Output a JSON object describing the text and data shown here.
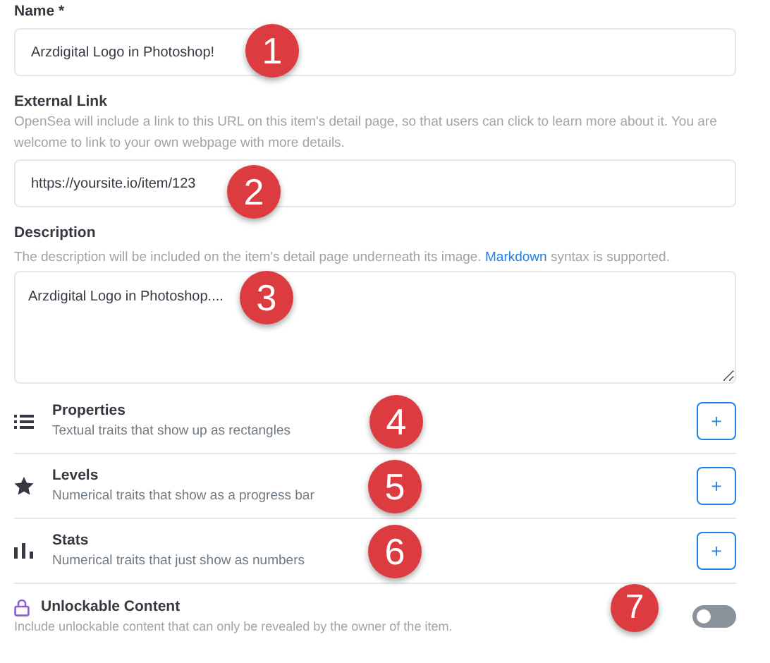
{
  "name_field": {
    "label": "Name *",
    "value": "Arzdigital Logo in Photoshop!",
    "badge": "1"
  },
  "external_link": {
    "label": "External Link",
    "hint": "OpenSea will include a link to this URL on this item's detail page, so that users can click to learn more about it. You are welcome to link to your own webpage with more details.",
    "value": "https://yoursite.io/item/123",
    "badge": "2"
  },
  "description": {
    "label": "Description",
    "hint_before": "The description will be included on the item's detail page underneath its image.",
    "hint_link": "Markdown",
    "hint_after": "syntax is supported.",
    "value": "Arzdigital Logo in Photoshop....",
    "badge": "3"
  },
  "traits": [
    {
      "kind": "list",
      "title": "Properties",
      "subtitle": "Textual traits that show up as rectangles",
      "button": "+",
      "badge": "4"
    },
    {
      "kind": "star",
      "title": "Levels",
      "subtitle": "Numerical traits that show as a progress bar",
      "button": "+",
      "badge": "5"
    },
    {
      "kind": "bars",
      "title": "Stats",
      "subtitle": "Numerical traits that just show as numbers",
      "button": "+",
      "badge": "6"
    }
  ],
  "unlockable": {
    "title": "Unlockable Content",
    "hint": "Include unlockable content that can only be revealed by the owner of the item.",
    "on": false,
    "badge": "7"
  }
}
